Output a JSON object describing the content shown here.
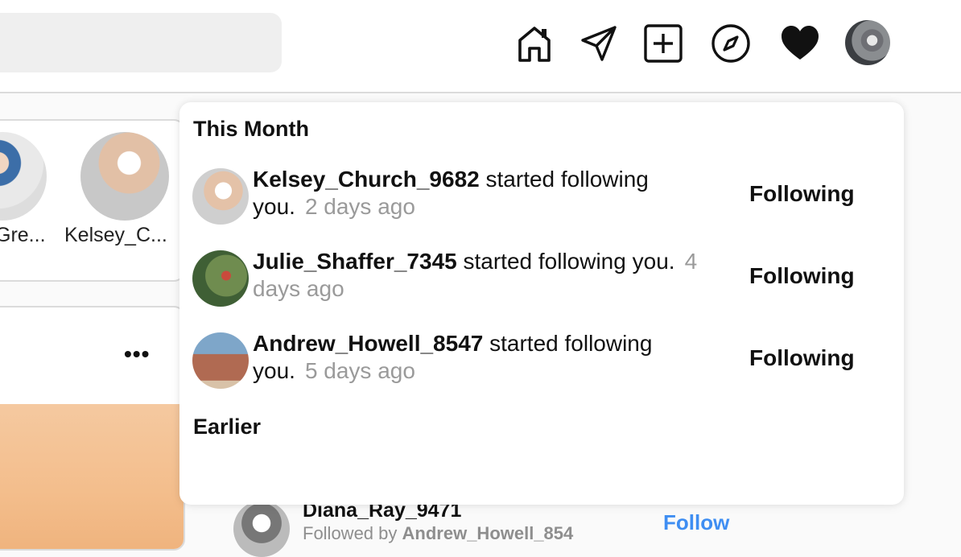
{
  "nav": {
    "icons": [
      "home-icon",
      "send-icon",
      "new-post-icon",
      "explore-icon",
      "heart-icon",
      "avatar"
    ]
  },
  "stories": [
    {
      "name": "Gre..."
    },
    {
      "name": "Kelsey_C..."
    }
  ],
  "post": {
    "more": "•••"
  },
  "suggestion": {
    "name": "Diana_Ray_9471",
    "sub_prefix": "Followed by ",
    "sub_user": "Andrew_Howell_854",
    "follow_label": "Follow"
  },
  "activity": {
    "this_month_title": "This Month",
    "earlier_title": "Earlier",
    "items": [
      {
        "user": "Kelsey_Church_9682",
        "action": "started following",
        "you": "you.",
        "time": "2 days ago",
        "button": "Following"
      },
      {
        "user": "Julie_Shaffer_7345",
        "action": "started following",
        "you": "you.",
        "time": "4 days ago",
        "button": "Following"
      },
      {
        "user": "Andrew_Howell_8547",
        "action": "started following",
        "you": "you.",
        "time": "5 days ago",
        "button": "Following"
      }
    ]
  },
  "colors": {
    "accent": "#3f8ef2",
    "muted": "#9a9a9a"
  }
}
